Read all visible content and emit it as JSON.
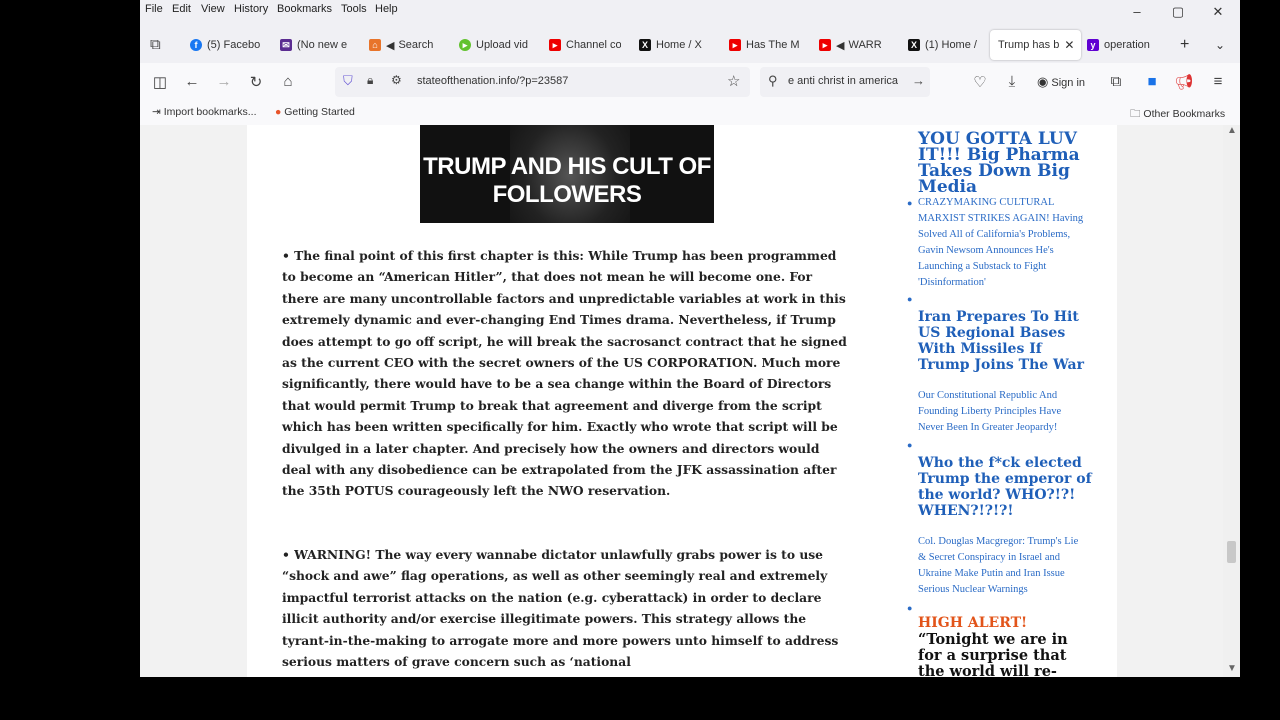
{
  "menubar": {
    "items": [
      "File",
      "Edit",
      "View",
      "History",
      "Bookmarks",
      "Tools",
      "Help"
    ]
  },
  "window_controls": {
    "minimize": "–",
    "maximize": "▢",
    "close": "✕"
  },
  "tabs": [
    {
      "label": "(5) Facebo",
      "icon": "facebook-icon",
      "color": "#1877f2"
    },
    {
      "label": "(No new e",
      "icon": "mail-icon",
      "color": "#5b2c91"
    },
    {
      "label": "Search",
      "icon": "search-page-icon",
      "color": "#e8742a"
    },
    {
      "label": "Upload vid",
      "icon": "rumble-icon",
      "color": "#62c22f"
    },
    {
      "label": "Channel co",
      "icon": "youtube-icon",
      "color": "#e00"
    },
    {
      "label": "Home / X",
      "icon": "x-icon",
      "color": "#111"
    },
    {
      "label": "Has The M",
      "icon": "youtube-icon",
      "color": "#e00"
    },
    {
      "label": "WARR",
      "icon": "youtube-icon",
      "color": "#e00"
    },
    {
      "label": "(1) Home /",
      "icon": "x-icon",
      "color": "#111"
    },
    {
      "label": "Trump has b",
      "icon": "page-icon",
      "color": "#fff",
      "active": true
    },
    {
      "label": "operation",
      "icon": "yahoo-icon",
      "color": "#6001d2"
    }
  ],
  "nav": {
    "url": "stateofthenation.info/?p=23587",
    "search": "e anti christ in america",
    "sign_in": "Sign in"
  },
  "bookmarks": {
    "import": "Import bookmarks...",
    "getting_started": "Getting Started",
    "other": "Other Bookmarks"
  },
  "article": {
    "hero_text": "TRUMP AND HIS CULT OF FOLLOWERS",
    "para1": "• The final point of this first chapter is this: While Trump has been programmed to become an “American Hitler”, that does not mean he will become one. For there are many uncontrollable factors and unpredictable variables at work in this extremely dynamic and ever-changing End Times drama. Nevertheless, if Trump does attempt to go off script, he will break the sacrosanct contract that he signed as the current CEO with the secret owners of the US CORPORATION. Much more significantly, there would have to be a sea change within the Board of Directors that would permit Trump to break that agreement and diverge from the script which has been written specifically for him. Exactly who wrote that script will be divulged in a later chapter. And precisely how the owners and directors would deal with any disobedience can be extrapolated from the JFK assassination after the 35th POTUS courageously left the NWO reservation.",
    "para2": "• WARNING! The way every wannabe dictator unlawfully grabs power is to use “shock and awe” flag operations, as well as other seemingly real and extremely impactful terrorist attacks on the nation (e.g. cyberattack) in order to declare illicit authority and/or exercise illegitimate powers. This strategy allows the tyrant-in-the-making to arrogate more and more powers unto himself to address serious matters of grave concern such as ‘national"
  },
  "sidebar": {
    "head1": "YOU GOTTA LUV IT!!! Big Pharma Takes Down Big Media",
    "link1": "CRAZYMAKING CULTURAL MARXIST STRIKES AGAIN! Having Solved All of California's Problems, Gavin Newsom Announces He's Launching a Substack to Fight 'Disinformation'",
    "head2": "Iran Prepares To Hit US Regional Bases With Missiles If Trump Joins The War",
    "link2": "Our Constitutional Republic And Founding Liberty Principles Have Never Been In Greater Jeopardy!",
    "head3": "Who the f*ck elected Trump the emperor of the world? WHO?!?! WHEN?!?!?!",
    "link3": "Col. Douglas Macgregor: Trump's Lie & Secret Conspiracy in Israel and Ukraine Make Putin and Iran Issue Serious Nuclear Warnings",
    "alert": "HIGH ALERT!",
    "quote": "“Tonight we are in for a surprise that the world will re-"
  }
}
